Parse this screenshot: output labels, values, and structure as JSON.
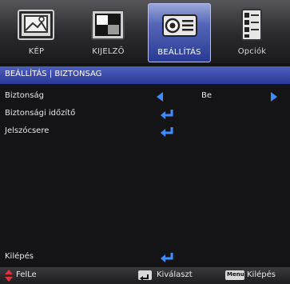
{
  "tabs": [
    {
      "label": "KÉP",
      "icon": "picture-icon"
    },
    {
      "label": "KIJELZŐ",
      "icon": "display-icon"
    },
    {
      "label": "BEÁLLÍTÁS",
      "icon": "projector-icon"
    },
    {
      "label": "Opciók",
      "icon": "options-list-icon"
    }
  ],
  "active_tab": "BEÁLLÍTÁS",
  "header": {
    "breadcrumb": "BEÁLLÍTÁS | BIZTONSAG"
  },
  "rows": [
    {
      "label": "Biztonság",
      "value": "Be",
      "control": "left-right-selector"
    },
    {
      "label": "Biztonsági időzítő",
      "control": "enter"
    },
    {
      "label": "Jelszócsere",
      "control": "enter"
    }
  ],
  "exit_row": {
    "label": "Kilépés",
    "control": "enter"
  },
  "footer": {
    "updown_text": "FelLe",
    "enter_text": "Kiválaszt",
    "menu_key": "Menu",
    "exit_text": "Kilépés"
  },
  "colors": {
    "accent": "#3f8cff",
    "header": "#3a48a8",
    "updown_icon": "#e0323a"
  }
}
